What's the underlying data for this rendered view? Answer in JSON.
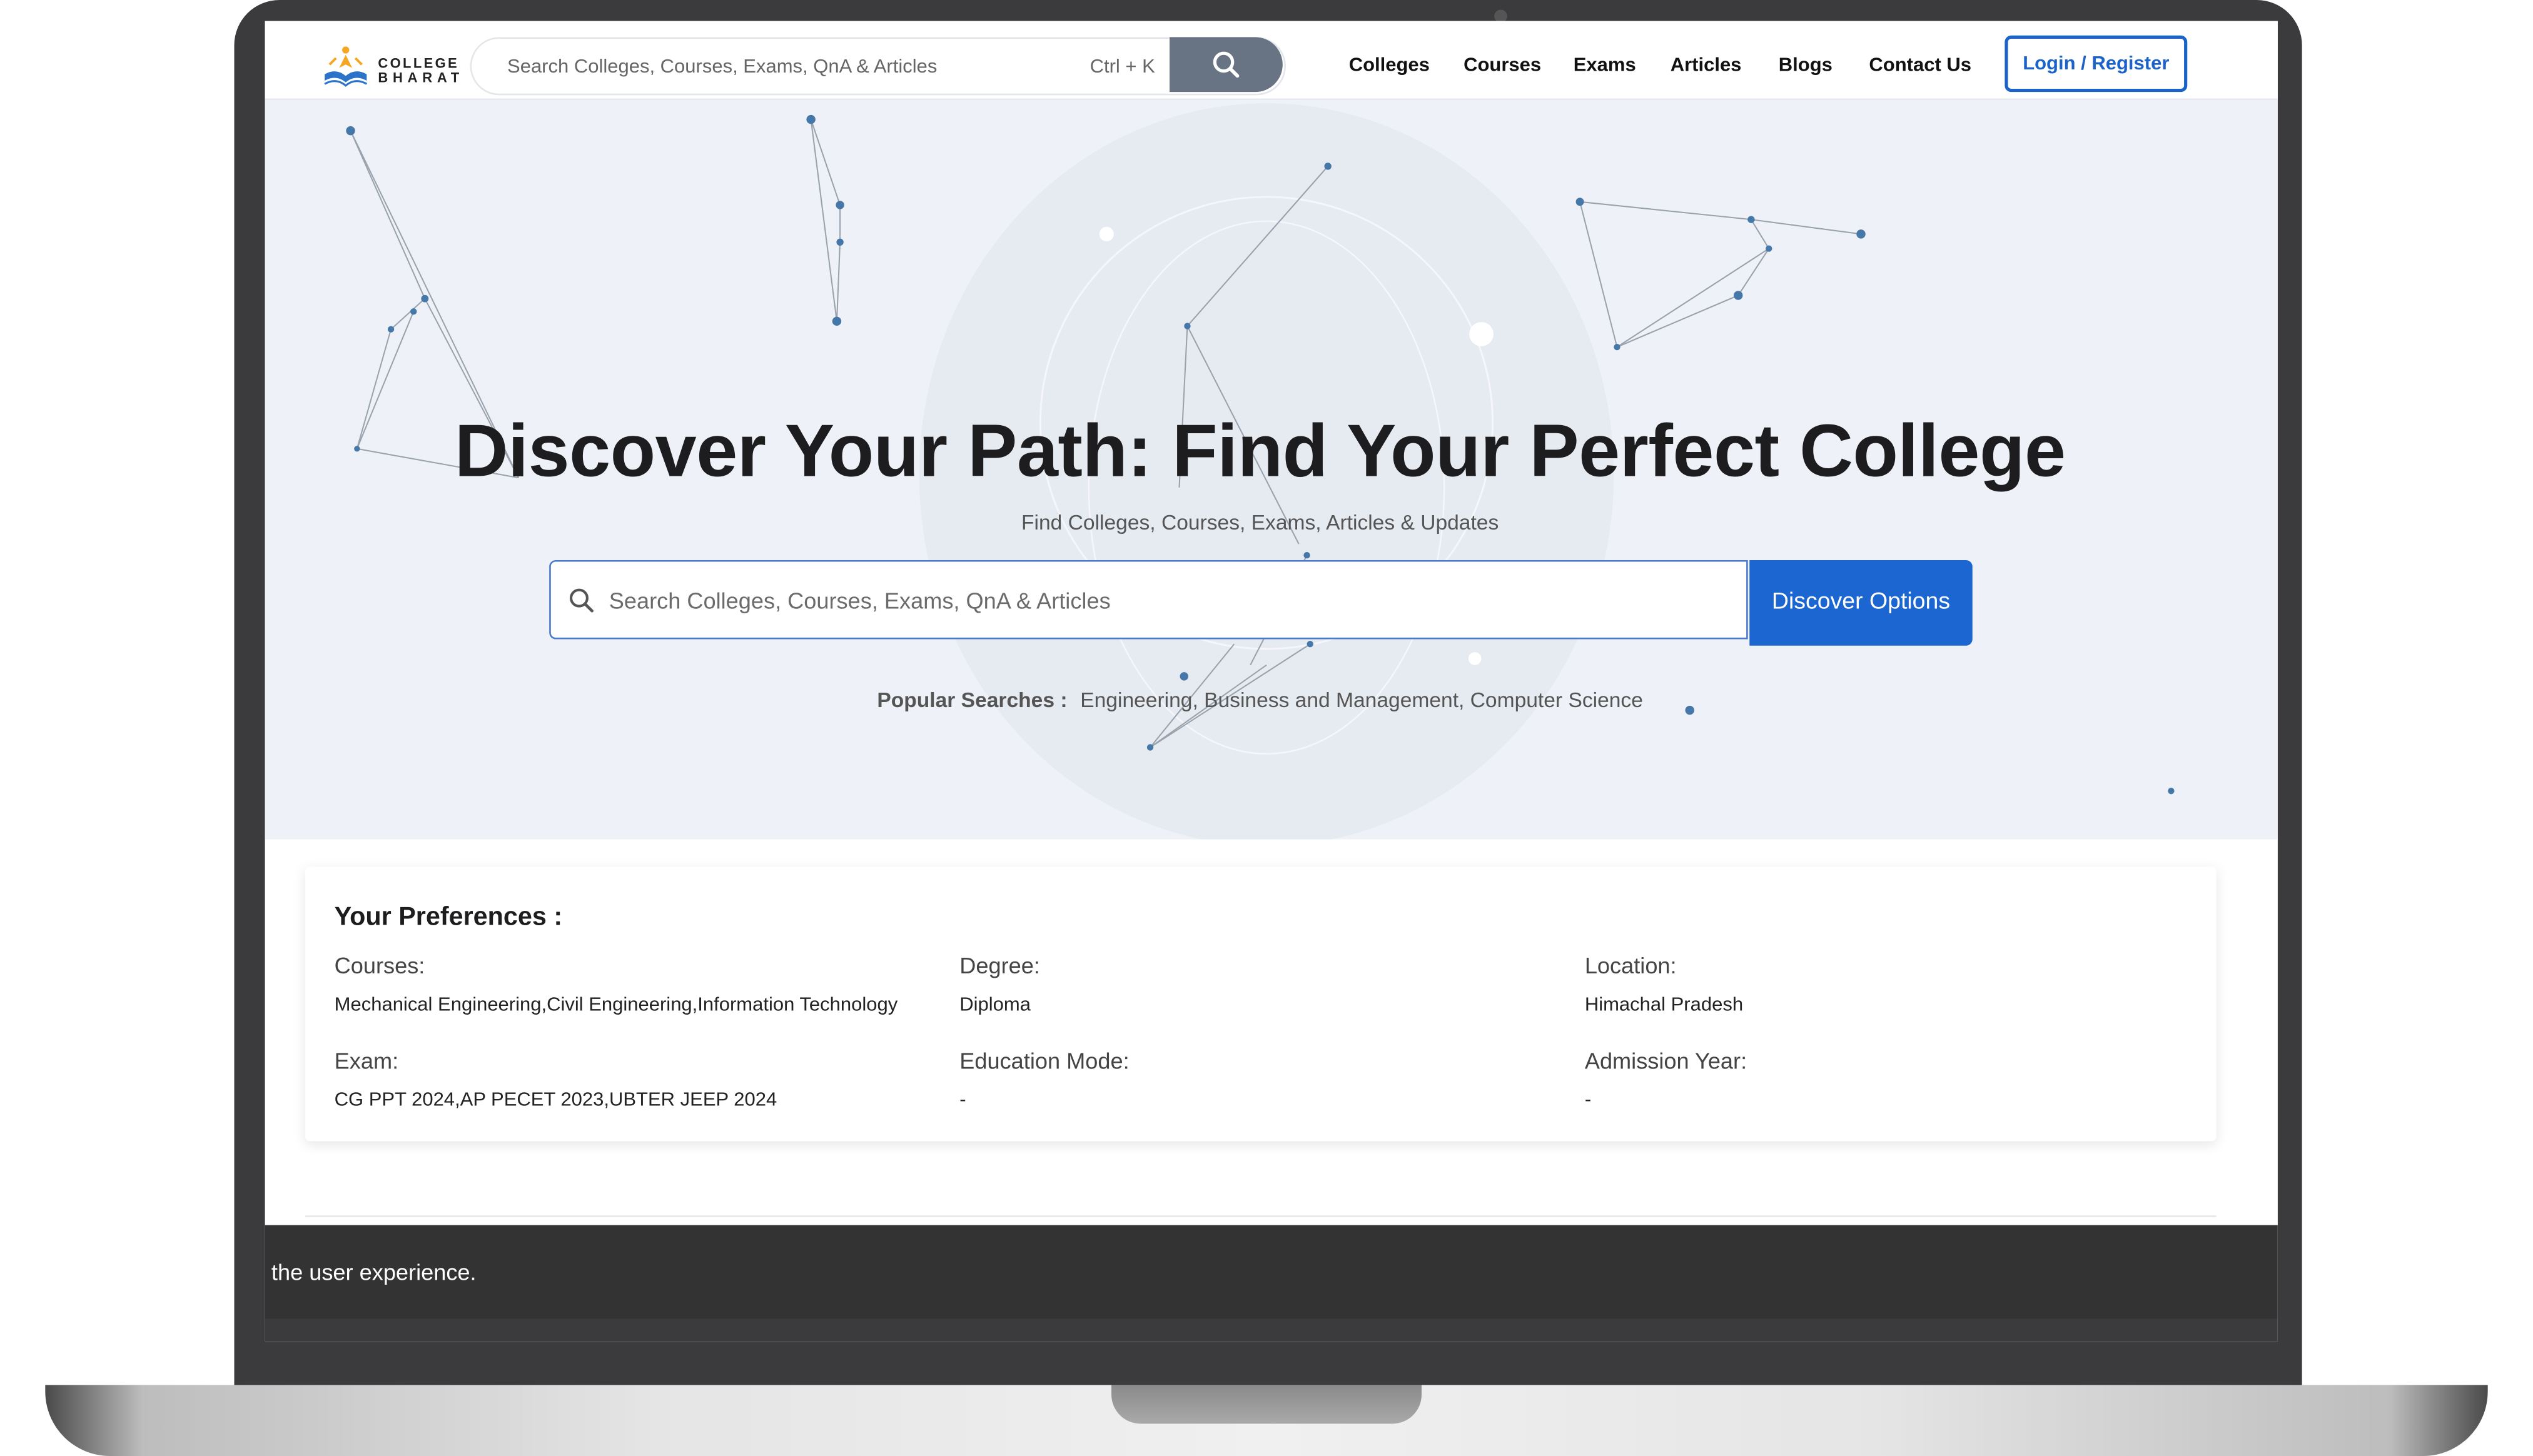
{
  "logo": {
    "line1": "COLLEGE",
    "line2": "BHARAT"
  },
  "navbar": {
    "search_placeholder": "Search Colleges, Courses, Exams, QnA & Articles",
    "shortcut": "Ctrl + K",
    "links": [
      "Colleges",
      "Courses",
      "Exams",
      "Articles",
      "Blogs",
      "Contact Us"
    ],
    "login_label": "Login / Register"
  },
  "hero": {
    "title": "Discover Your Path: Find Your Perfect College",
    "subtitle": "Find Colleges, Courses, Exams, Articles & Updates",
    "search_placeholder": "Search Colleges, Courses, Exams, QnA & Articles",
    "button_label": "Discover Options",
    "popular_label": "Popular Searches :",
    "popular_items": "Engineering, Business and Management, Computer Science"
  },
  "preferences": {
    "title": "Your Preferences :",
    "courses_label": "Courses:",
    "courses_value": "Mechanical Engineering,Civil Engineering,Information Technology",
    "degree_label": "Degree:",
    "degree_value": "Diploma",
    "location_label": "Location:",
    "location_value": "Himachal Pradesh",
    "exam_label": "Exam:",
    "exam_value": "CG PPT 2024,AP PECET 2023,UBTER JEEP 2024",
    "mode_label": "Education Mode:",
    "mode_value": "-",
    "year_label": "Admission Year:",
    "year_value": "-"
  },
  "cookie_bar": {
    "text": "the user experience."
  },
  "colors": {
    "primary": "#1c66d1",
    "hero_bg": "#eef2f8",
    "search_btn": "#687483",
    "cookie_bg": "#333333"
  }
}
